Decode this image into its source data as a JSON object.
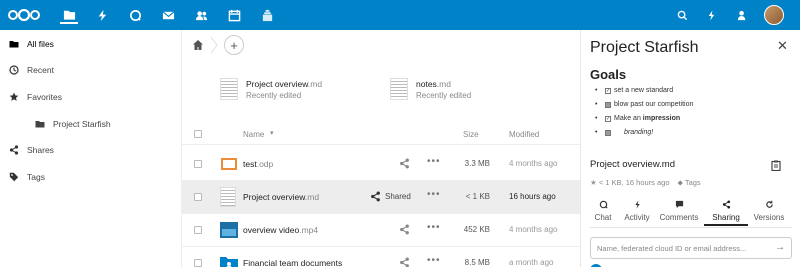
{
  "colors": {
    "brand": "#0082c9",
    "selected_row": "#ededed"
  },
  "topbar": {
    "apps": [
      {
        "icon": "files-icon"
      },
      {
        "icon": "activity-icon"
      },
      {
        "icon": "talk-icon"
      },
      {
        "icon": "mail-icon"
      },
      {
        "icon": "contacts-icon"
      },
      {
        "icon": "calendar-icon"
      },
      {
        "icon": "deck-icon"
      }
    ],
    "right_icons": [
      "search-icon",
      "notifications-icon",
      "contacts-menu-icon"
    ]
  },
  "sidebar": {
    "items": [
      {
        "label": "All files"
      },
      {
        "label": "Recent"
      },
      {
        "label": "Favorites"
      },
      {
        "label": "Project Starfish"
      },
      {
        "label": "Shares"
      },
      {
        "label": "Tags"
      }
    ]
  },
  "recent": [
    {
      "name": "Project overview",
      "ext": ".md",
      "sub": "Recently edited"
    },
    {
      "name": "notes",
      "ext": ".md",
      "sub": "Recently edited"
    }
  ],
  "table": {
    "headers": {
      "name": "Name",
      "size": "Size",
      "modified": "Modified"
    },
    "rows": [
      {
        "name": "test",
        "ext": ".odp",
        "size": "3.3 MB",
        "modified": "4 months ago"
      },
      {
        "name": "Project overview",
        "ext": ".md",
        "shared": "Shared",
        "size": "< 1 KB",
        "modified": "16 hours ago"
      },
      {
        "name": "overview video",
        "ext": ".mp4",
        "size": "452 KB",
        "modified": "4 months ago"
      },
      {
        "name": "Financial team documents",
        "ext": "",
        "size": "8.5 MB",
        "modified": "a month ago"
      }
    ]
  },
  "panel": {
    "title": "Project Starfish",
    "goals_heading": "Goals",
    "todos": [
      {
        "text": "set a new standard",
        "checked": true
      },
      {
        "text": "blow past our competition",
        "checked": false
      },
      {
        "text_pre": "Make an ",
        "text_bold": "impression",
        "checked": true
      },
      {
        "text": "branding!",
        "checked": false
      }
    ],
    "file_title": "Project overview.md",
    "file_meta": "< 1 KB, 16 hours ago",
    "tags_label": "Tags",
    "tabs": [
      {
        "label": "Chat",
        "icon": "chat-icon"
      },
      {
        "label": "Activity",
        "icon": "activity-icon"
      },
      {
        "label": "Comments",
        "icon": "comments-icon"
      },
      {
        "label": "Sharing",
        "icon": "share-icon"
      },
      {
        "label": "Versions",
        "icon": "versions-icon"
      }
    ],
    "share_placeholder": "Name, federated cloud ID or email address..."
  }
}
